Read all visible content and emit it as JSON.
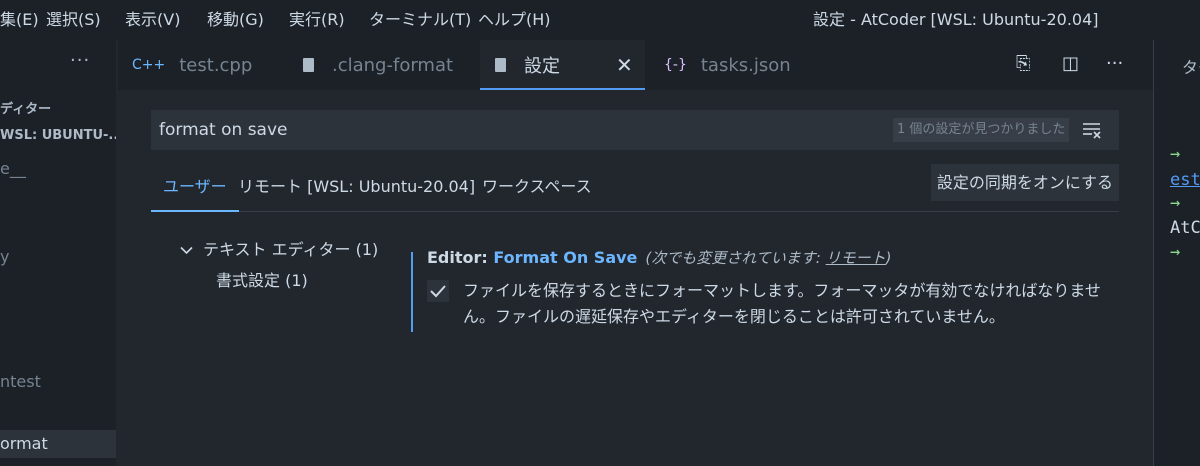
{
  "menu": [
    "集(E)",
    "選択(S)",
    "表示(V)",
    "移動(G)",
    "実行(R)",
    "ターミナル(T)",
    "ヘルプ(H)"
  ],
  "window_title": "設定 - AtCoder [WSL: Ubuntu-20.04]",
  "sidebar": {
    "more": "···",
    "items": [
      "ディター",
      "WSL: UBUNTU-...",
      "e__",
      "y",
      "ntest",
      "ormat"
    ]
  },
  "tabs": [
    {
      "icon": "C++",
      "label": "test.cpp"
    },
    {
      "label": ".clang-format"
    },
    {
      "label": "設定",
      "close": "✕"
    },
    {
      "icon": "{-}",
      "label": "tasks.json"
    }
  ],
  "tab_actions": {
    "open_json": "⎘",
    "split": "◫",
    "more": "···"
  },
  "right_panel": {
    "tab": "ター",
    "lines": [
      "→",
      "est",
      "→",
      "AtC",
      "→"
    ]
  },
  "search": {
    "value": "format on save",
    "count": "1 個の設定が見つかりました"
  },
  "settings_tabs": [
    "ユーザー",
    "リモート [WSL: Ubuntu-20.04]",
    "ワークスペース"
  ],
  "sync_button": "設定の同期をオンにする",
  "toc": {
    "group": "テキスト エディター (1)",
    "item": "書式設定 (1)"
  },
  "setting": {
    "category": "Editor: ",
    "name": "Format On Save",
    "modified_prefix": "(次でも変更されています: ",
    "modified_link": "リモート",
    "modified_suffix": ")",
    "checked": true,
    "description": "ファイルを保存するときにフォーマットします。フォーマッタが有効でなければなりません。ファイルの遅延保存やエディターを閉じることは許可されていません。"
  },
  "colors": {
    "accent": "#6cb6ff",
    "terminal_arrow": "#8ddb8c",
    "terminal_link": "#539bf5"
  }
}
